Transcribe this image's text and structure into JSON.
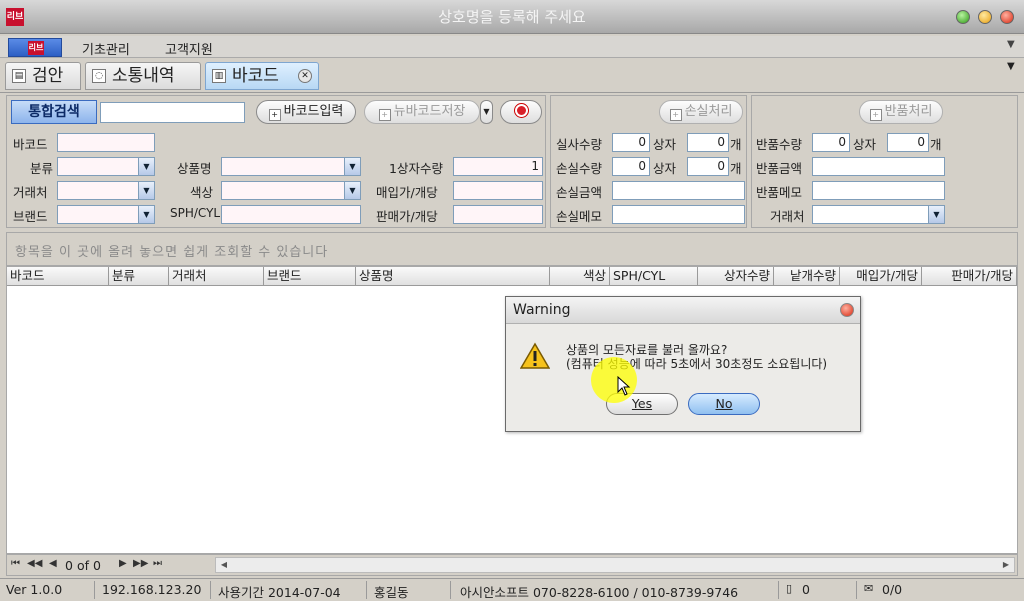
{
  "window": {
    "title": "상호명을 등록해 주세요",
    "logo_text": "리브"
  },
  "menubar": {
    "items": [
      "기초관리",
      "고객지원"
    ]
  },
  "tabs": [
    {
      "label": "검안",
      "icon": "document-icon"
    },
    {
      "label": "소통내역",
      "icon": "speech-bubble-icon"
    },
    {
      "label": "바코드",
      "icon": "barcode-icon",
      "active": true
    }
  ],
  "search": {
    "button_label": "통합검색",
    "value": "",
    "barcode_input_label": "바코드입력",
    "new_barcode_save_label": "뉴바코드저장"
  },
  "form": {
    "barcode_label": "바코드",
    "category_label": "분류",
    "vendor_label": "거래처",
    "brand_label": "브랜드",
    "product_name_label": "상품명",
    "color_label": "색상",
    "sph_cyl_label": "SPH/CYL",
    "qty_per_box_label": "1상자수량",
    "qty_per_box_value": "1",
    "purchase_price_label": "매입가/개당",
    "sale_price_label": "판매가/개당"
  },
  "loss": {
    "process_label": "손실처리",
    "actual_qty_label": "실사수량",
    "actual_qty_value": "0",
    "box_label": "상자",
    "box_value": "0",
    "unit_label": "개",
    "loss_qty_label": "손실수량",
    "loss_qty_value": "0",
    "loss_box_value": "0",
    "loss_amount_label": "손실금액",
    "loss_memo_label": "손실메모"
  },
  "return": {
    "process_label": "반품처리",
    "return_qty_label": "반품수량",
    "return_qty_value": "0",
    "box_label": "상자",
    "box_value": "0",
    "unit_label": "개",
    "return_amount_label": "반품금액",
    "return_memo_label": "반품메모",
    "vendor_label": "거래처"
  },
  "grid": {
    "drag_hint": "항목을 이 곳에 올려 놓으면 쉽게 조회할 수 있습니다",
    "columns": [
      "바코드",
      "분류",
      "거래처",
      "브랜드",
      "상품명",
      "색상",
      "SPH/CYL",
      "상자수량",
      "낱개수량",
      "매입가/개당",
      "판매가/개당"
    ]
  },
  "pager": {
    "current": "0",
    "of_label": "of",
    "total": "0"
  },
  "status": {
    "version": "Ver 1.0.0",
    "ip": "192.168.123.20",
    "period": "사용기간 2014-07-04",
    "user": "홍길동",
    "company": "아시안소프트 070-8228-6100 / 010-8739-9746",
    "count": "0",
    "messages": "0/0"
  },
  "dialog": {
    "title": "Warning",
    "message_line1": "상품의 모든자료를 불러 올까요?",
    "message_line2": "(컴퓨터 성능에 따라 5초에서 30초정도 소요됩니다)",
    "yes_label": "Yes",
    "no_label": "No"
  }
}
